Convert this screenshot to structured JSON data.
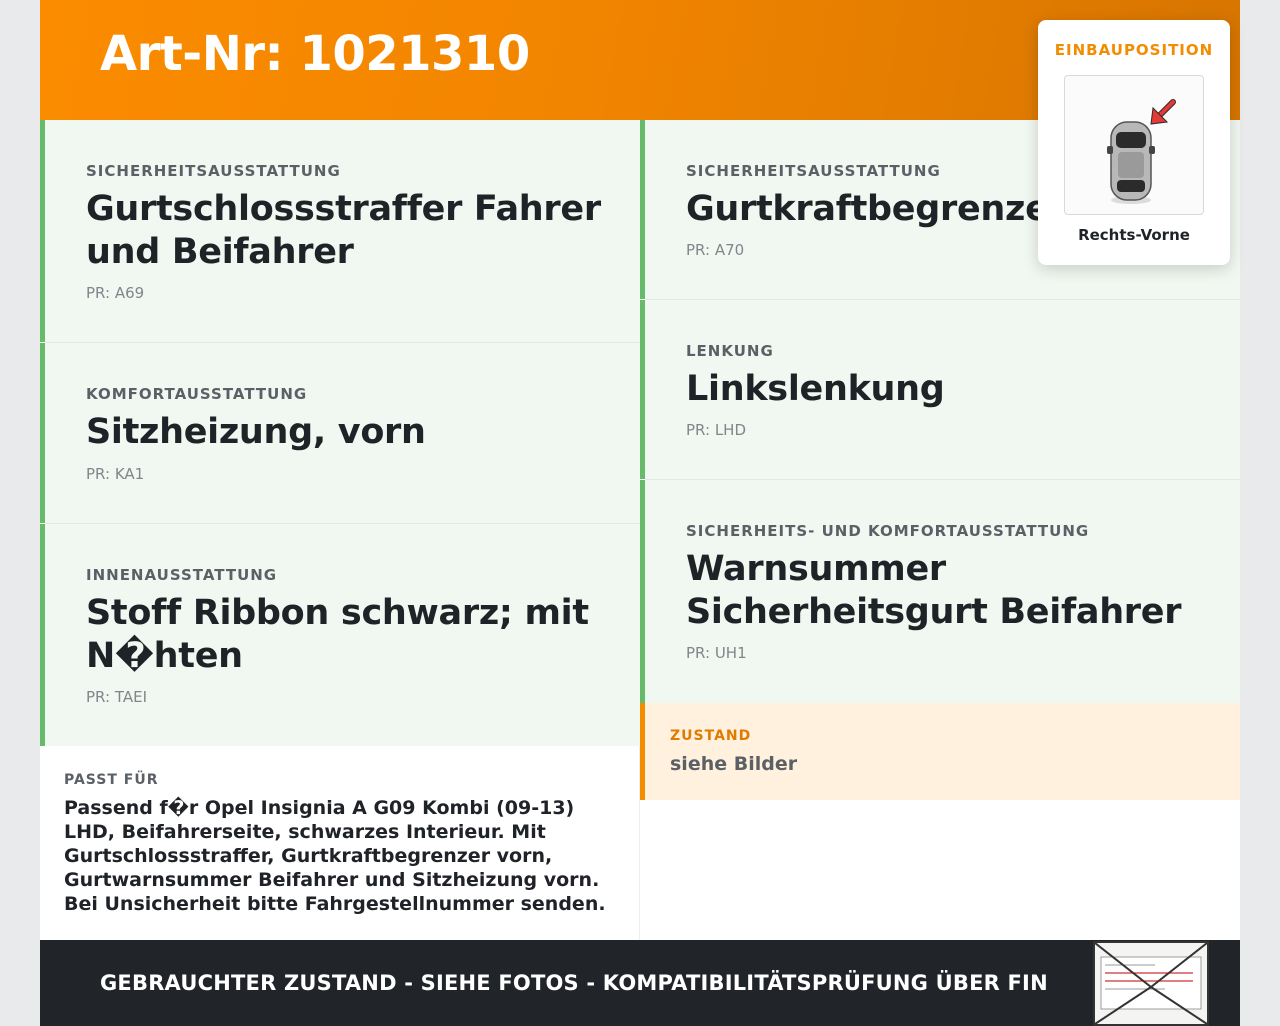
{
  "header": {
    "title": "Art-Nr: 1021310"
  },
  "left_cards": [
    {
      "label": "SICHERHEITSAUSSTATTUNG",
      "value": "Gurtschlossstraffer Fahrer und Beifahrer",
      "pr": "PR: A69"
    },
    {
      "label": "KOMFORTAUSSTATTUNG",
      "value": "Sitzheizung, vorn",
      "pr": "PR: KA1"
    },
    {
      "label": "INNENAUSSTATTUNG",
      "value": "Stoff Ribbon schwarz; mit N�hten",
      "pr": "PR: TAEI"
    }
  ],
  "right_cards": [
    {
      "label": "SICHERHEITSAUSSTATTUNG",
      "value": "Gurtkraftbegrenzer vorn",
      "pr": "PR: A70"
    },
    {
      "label": "LENKUNG",
      "value": "Linkslenkung",
      "pr": "PR: LHD"
    },
    {
      "label": "SICHERHEITS- UND KOMFORTAUSSTATTUNG",
      "value": "Warnsummer Sicherheitsgurt Beifahrer",
      "pr": "PR: UH1"
    }
  ],
  "fits": {
    "label": "PASST FÜR",
    "text": "Passend f�r Opel Insignia A G09 Kombi (09-13) LHD, Beifahrerseite, schwarzes Interieur. Mit Gurtschlossstraffer, Gurtkraftbegrenzer vorn, Gurtwarnsummer Beifahrer und Sitzheizung vorn. Bei Unsicherheit bitte Fahrgestellnummer senden."
  },
  "condition": {
    "label": "ZUSTAND",
    "value": "siehe Bilder"
  },
  "footer": {
    "text": "GEBRAUCHTER ZUSTAND - SIEHE FOTOS - KOMPATIBILITÄTSPRÜFUNG ÜBER FIN"
  },
  "install_popup": {
    "label": "EINBAUPOSITION",
    "position": "Rechts-Vorne",
    "car_icon": "car-top-view-icon",
    "arrow_icon": "red-arrow-icon"
  },
  "stamp": {
    "icon": "document-envelope-icon"
  },
  "colors": {
    "accent": "#f28c00",
    "card_border": "#66bb6a",
    "card_bg": "#f1f8f1",
    "footer_bg": "#212529",
    "arrow": "#e53935"
  }
}
